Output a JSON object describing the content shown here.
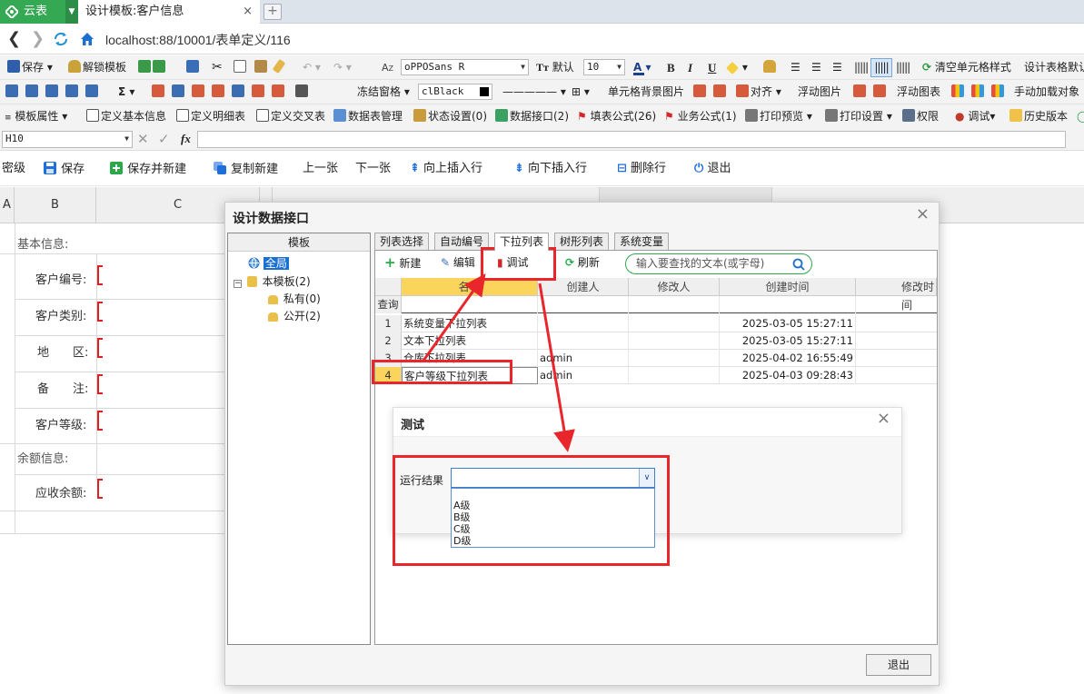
{
  "app": {
    "name": "云表"
  },
  "tab": {
    "title": "设计模板:客户信息",
    "close": "×",
    "new": "+"
  },
  "address": {
    "url": "localhost:88/10001/表单定义/116"
  },
  "toolbar1": {
    "save": "保存",
    "unlock": "解锁模板",
    "font_name": "oPPOSans R",
    "default": "默认",
    "font_size": "10",
    "bold": "B",
    "italic": "I",
    "underline": "U",
    "clear_style": "清空单元格样式",
    "set_default": "设计表格默认"
  },
  "toolbar2": {
    "sigma": "Σ",
    "freeze": "冻结窗格",
    "color": "clBlack",
    "cell_bg_image": "单元格背景图片",
    "align": "对齐",
    "float_image": "浮动图片",
    "float_chart": "浮动图表",
    "manual_load": "手动加载对象"
  },
  "toolbar3": {
    "template_attr": "模板属性",
    "define_basic": "定义基本信息",
    "define_detail": "定义明细表",
    "define_cross": "定义交叉表",
    "data_table_mgr": "数据表管理",
    "status_setting": "状态设置(0)",
    "data_interface": "数据接口(2)",
    "fill_formula": "填表公式(26)",
    "biz_formula": "业务公式(1)",
    "print_preview": "打印预览",
    "print_setting": "打印设置",
    "permission": "权限",
    "debug": "调试",
    "history": "历史版本"
  },
  "formula": {
    "cell_ref": "H10",
    "fx": "fx"
  },
  "actions": {
    "secret": "密级",
    "save": "保存",
    "save_new": "保存并新建",
    "copy_new": "复制新建",
    "prev": "上一张",
    "next": "下一张",
    "insert_up": "向上插入行",
    "insert_down": "向下插入行",
    "delete_row": "删除行",
    "exit": "退出"
  },
  "sheet": {
    "columns": [
      "A",
      "B",
      "C"
    ],
    "section_basic": "基本信息:",
    "customer_no": "客户编号:",
    "customer_type": "客户类别:",
    "region": "地　　区:",
    "remark": "备　　注:",
    "customer_level": "客户等级:",
    "section_balance": "余额信息:",
    "receivable": "应收余额:"
  },
  "dialog": {
    "title": "设计数据接口",
    "close": "×",
    "tree": {
      "header": "模板",
      "global": "全局",
      "this_template": "本模板(2)",
      "private": "私有(0)",
      "public": "公开(2)"
    },
    "tabs": [
      "列表选择",
      "自动编号",
      "下拉列表",
      "树形列表",
      "系统变量"
    ],
    "toolbar": {
      "new": "新建",
      "edit": "编辑",
      "debug": "调试",
      "refresh": "刷新",
      "search_placeholder": "输入要查找的文本(或字母)"
    },
    "grid": {
      "headers": [
        "名称",
        "创建人",
        "修改人",
        "创建时间",
        "修改时间"
      ],
      "query": "查询",
      "rows": [
        {
          "n": "1",
          "name": "系统变量下拉列表",
          "creator": "",
          "modifier": "",
          "created": "2025-03-05 15:27:11"
        },
        {
          "n": "2",
          "name": "文本下拉列表",
          "creator": "",
          "modifier": "",
          "created": "2025-03-05 15:27:11"
        },
        {
          "n": "3",
          "name": "仓库下拉列表",
          "creator": "admin",
          "modifier": "",
          "created": "2025-04-02 16:55:49"
        },
        {
          "n": "4",
          "name": "客户等级下拉列表",
          "creator": "admin",
          "modifier": "",
          "created": "2025-04-03 09:28:43"
        }
      ]
    },
    "exit": "退出"
  },
  "test_dialog": {
    "title": "测试",
    "close": "×",
    "label": "运行结果",
    "options": [
      "A级",
      "B级",
      "C级",
      "D级"
    ]
  },
  "colors": {
    "accent_green": "#34a853",
    "highlight_red": "#e8262b",
    "selection_yellow": "#fbd45b",
    "link_blue": "#1a6fd1"
  }
}
